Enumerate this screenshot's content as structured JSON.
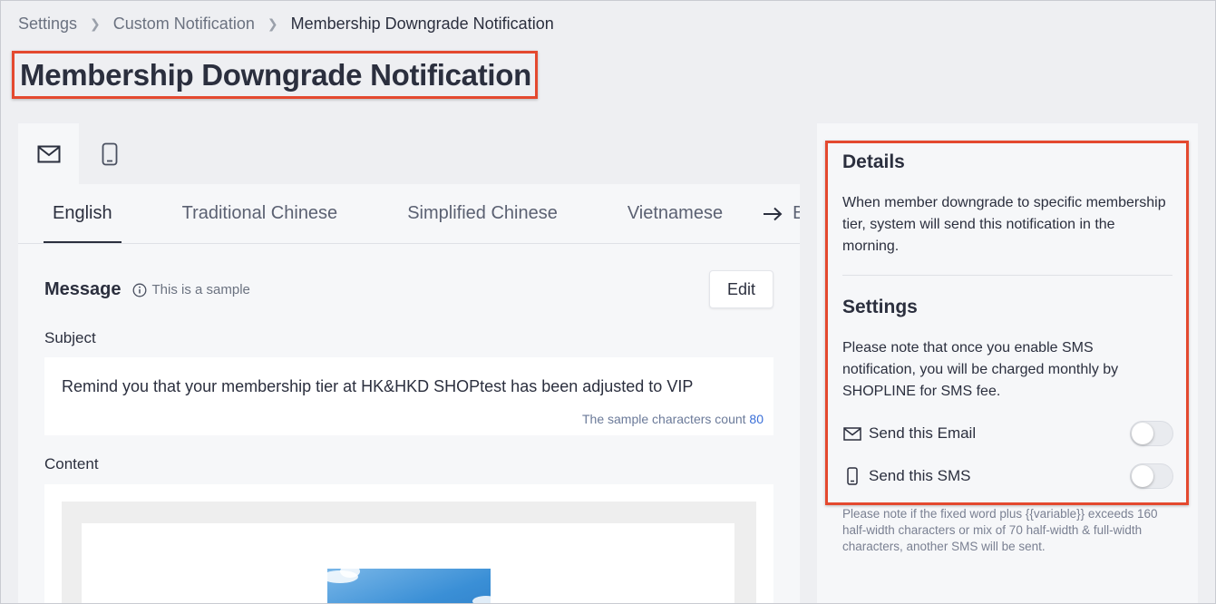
{
  "breadcrumb": {
    "items": [
      "Settings",
      "Custom Notification"
    ],
    "current": "Membership Downgrade Notification"
  },
  "page_title": "Membership Downgrade Notification",
  "channel_tabs": [
    {
      "icon": "mail-icon",
      "active": true
    },
    {
      "icon": "mobile-phone-icon",
      "active": false
    }
  ],
  "language_tabs": [
    "English",
    "Traditional Chinese",
    "Simplified Chinese",
    "Vietnamese",
    "Bahas"
  ],
  "message": {
    "label": "Message",
    "sample_note": "This is a sample",
    "edit_label": "Edit",
    "subject_label": "Subject",
    "subject_value": "Remind you that your membership tier at HK&HKD SHOPtest has been adjusted to VIP",
    "count_label": "The sample characters count",
    "count_value": "80",
    "content_label": "Content"
  },
  "details": {
    "heading": "Details",
    "text": "When member downgrade to specific membership tier, system will send this notification in the morning."
  },
  "settings": {
    "heading": "Settings",
    "text": "Please note that once you enable SMS notification, you will be charged monthly by SHOPLINE for SMS fee.",
    "email_toggle_label": "Send this Email",
    "email_enabled": false,
    "sms_toggle_label": "Send this SMS",
    "sms_enabled": false,
    "sms_note": "Please note if the fixed word plus {{variable}} exceeds 160 half-width characters or mix of 70 half-width & full-width characters, another SMS will be sent."
  },
  "colors": {
    "highlight": "#e4492f",
    "background": "#eeeff2",
    "link": "#3a6fd8"
  }
}
